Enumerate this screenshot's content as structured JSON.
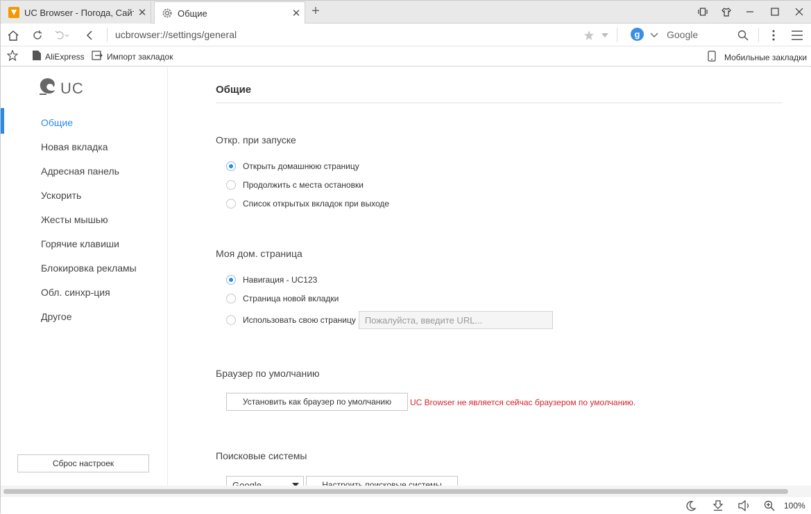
{
  "tabs": [
    {
      "title": "UC Browser - Погода, Сайт, Н",
      "active": false
    },
    {
      "title": "Общие",
      "active": true
    }
  ],
  "navbar": {
    "url": "ucbrowser://settings/general",
    "search_engine": "Google",
    "search_engine_badge": "g"
  },
  "bookmarks": {
    "items": [
      "AliExpress",
      "Импорт закладок"
    ],
    "mobile": "Мобильные закладки"
  },
  "sidebar": {
    "logo": "UC",
    "items": [
      "Общие",
      "Новая вкладка",
      "Адресная панель",
      "Ускорить",
      "Жесты мышью",
      "Горячие клавиши",
      "Блокировка рекламы",
      "Обл. синхр-ция",
      "Другое"
    ],
    "active_index": 0,
    "reset_label": "Сброс настроек"
  },
  "main": {
    "title": "Общие",
    "startup": {
      "heading": "Откр. при запуске",
      "options": [
        "Открыть домашнюю страницу",
        "Продолжить с места остановки",
        "Список открытых вкладок при выходе"
      ],
      "selected_index": 0
    },
    "homepage": {
      "heading": "Моя дом. страница",
      "options": [
        "Навигация - UC123",
        "Страница новой вкладки",
        "Использовать свою страницу"
      ],
      "selected_index": 0,
      "url_placeholder": "Пожалуйста, введите URL..."
    },
    "default_browser": {
      "heading": "Браузер по умолчанию",
      "button_label": "Установить как браузер по умолчанию",
      "warning": "UC Browser не является сейчас браузером по умолчанию."
    },
    "search": {
      "heading": "Поисковые системы",
      "selected_engine": "Google",
      "configure_label": "Настроить поисковые системы"
    }
  },
  "statusbar": {
    "zoom": "100%"
  },
  "colors": {
    "accent": "#2b8ae6",
    "warning": "#d3232a",
    "uc_orange": "#f39800"
  }
}
